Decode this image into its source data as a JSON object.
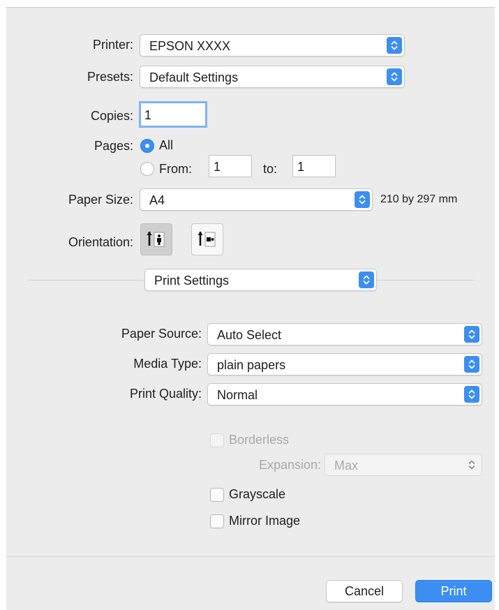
{
  "dialog": {
    "printer": {
      "label": "Printer:",
      "value": "EPSON XXXX"
    },
    "presets": {
      "label": "Presets:",
      "value": "Default Settings"
    },
    "copies": {
      "label": "Copies:",
      "value": "1"
    },
    "pages": {
      "label": "Pages:",
      "all_label": "All",
      "from_label": "From:",
      "from_value": "1",
      "to_label": "to:",
      "to_value": "1",
      "selected": "All"
    },
    "paper_size": {
      "label": "Paper Size:",
      "value": "A4",
      "dimensions": "210 by 297 mm"
    },
    "orientation": {
      "label": "Orientation:",
      "selected": "portrait"
    },
    "panel_menu": {
      "value": "Print Settings"
    },
    "print_settings": {
      "paper_source": {
        "label": "Paper Source:",
        "value": "Auto Select"
      },
      "media_type": {
        "label": "Media Type:",
        "value": "plain papers"
      },
      "print_quality": {
        "label": "Print Quality:",
        "value": "Normal"
      },
      "borderless": {
        "label": "Borderless",
        "checked": false,
        "enabled": false
      },
      "expansion": {
        "label": "Expansion:",
        "value": "Max",
        "enabled": false
      },
      "grayscale": {
        "label": "Grayscale",
        "checked": false
      },
      "mirror_image": {
        "label": "Mirror Image",
        "checked": false
      }
    },
    "buttons": {
      "cancel": "Cancel",
      "print": "Print"
    }
  },
  "colors": {
    "accent": "#3b8ef2",
    "dialog_bg": "#ececec",
    "disabled_text": "#a9a9a9"
  },
  "icons": [
    "chevron-updown-icon",
    "portrait-orientation-icon",
    "landscape-orientation-icon"
  ]
}
